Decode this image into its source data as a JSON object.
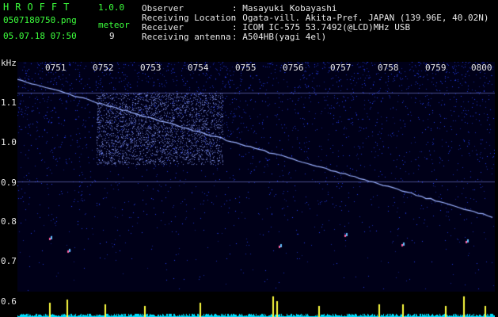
{
  "header": {
    "brand": "HROFFT",
    "version": "1.0.0",
    "filename": "0507180750.png",
    "datetime": "05.07.18 07:50",
    "meteor_label": "meteor",
    "meteor_count": "9"
  },
  "info": [
    {
      "label": "Observer",
      "value": ": Masayuki Kobayashi"
    },
    {
      "label": "Receiving Location",
      "value": ": Ogata-vill. Akita-Pref. JAPAN (139.96E, 40.02N)"
    },
    {
      "label": "Receiver",
      "value": ": ICOM IC-575 53.7492(@LCD)MHz USB"
    },
    {
      "label": "Receiving antenna",
      "value": ": A504HB(yagi 4el)"
    }
  ],
  "axis": {
    "unit": "kHz",
    "y_labels": [
      "1.1",
      "1.0",
      "0.9",
      "0.8",
      "0.7",
      "0.6"
    ],
    "time_labels": [
      "0751",
      "0752",
      "0753",
      "0754",
      "0755",
      "0756",
      "0757",
      "0758",
      "0759",
      "0800"
    ]
  },
  "colors": {
    "noise": "#2030ff",
    "trace": "#9ab0ff",
    "grid": "#c8c8c8",
    "text_green": "#3cff3c",
    "level": "#00e0ff",
    "meteor": "#ffff40"
  }
}
